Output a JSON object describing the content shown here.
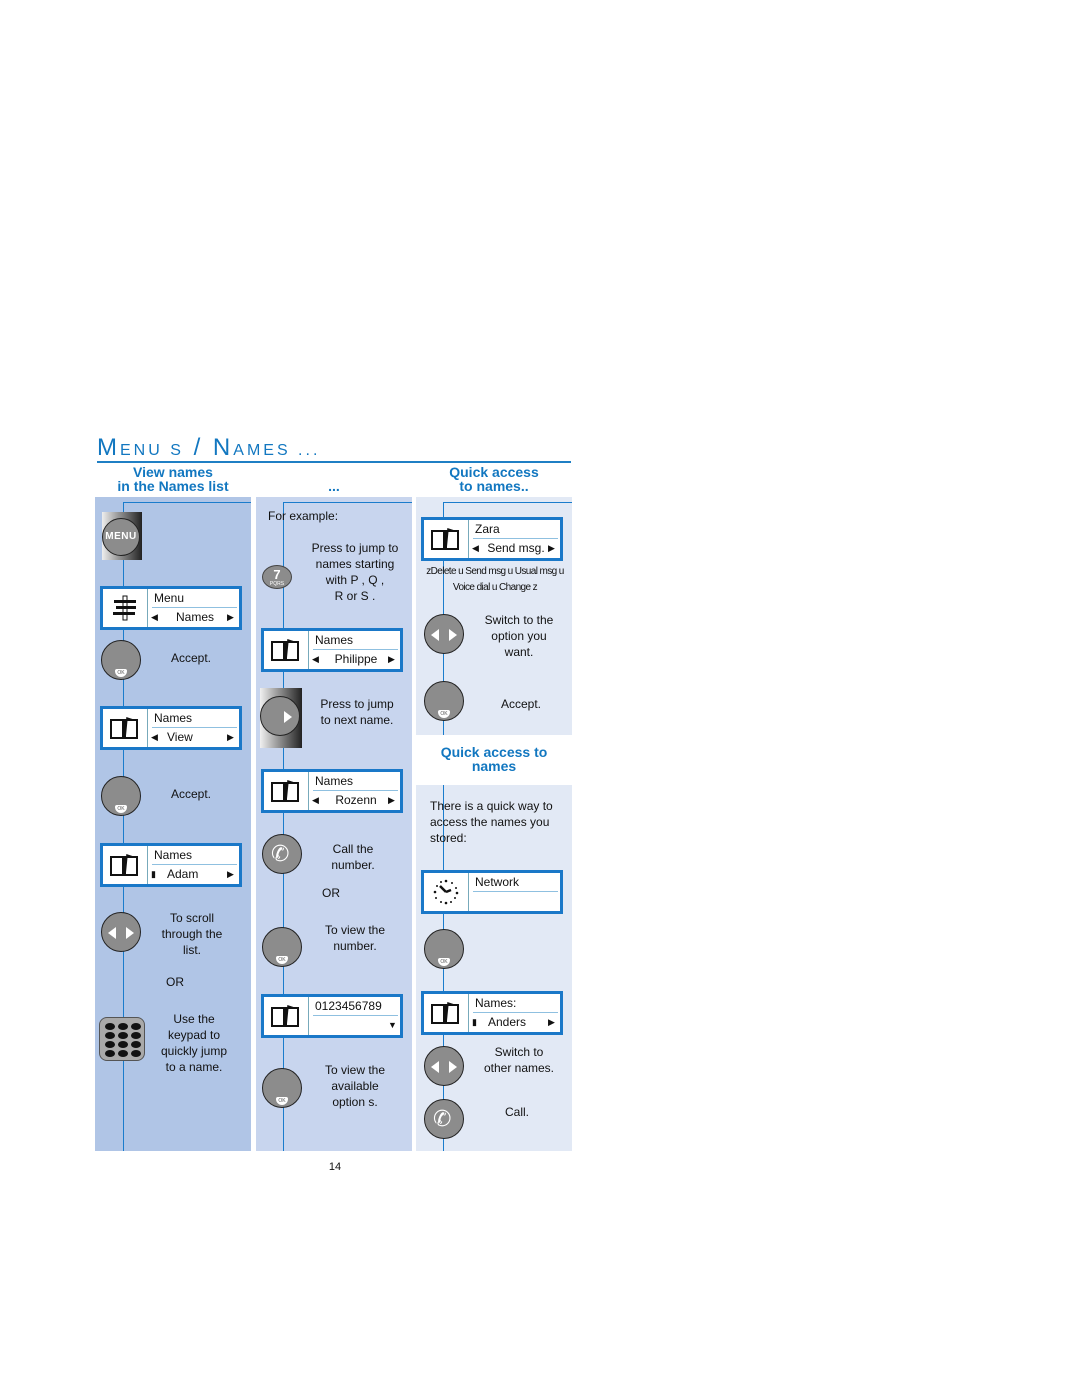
{
  "page": {
    "title_parts": [
      {
        "text": "M",
        "size": "big"
      },
      {
        "text": "ENU S",
        "size": "sm"
      },
      {
        "text": " / ",
        "size": "big"
      },
      {
        "text": "N",
        "size": "big"
      },
      {
        "text": "AMES ...",
        "size": "sm"
      }
    ],
    "page_number": "14",
    "accent_color": "#1277c0"
  },
  "columns": {
    "col1_head": [
      "View names",
      "in the Names list"
    ],
    "col2_head": "...",
    "col3_head": [
      "Quick access",
      "to names.."
    ],
    "col3_subhead": [
      "Quick access to",
      "names"
    ]
  },
  "col1": {
    "menu_key_label": "MENU",
    "screen_menu": {
      "line1": "Menu",
      "line2": "Names",
      "icon": "menu-tools-icon"
    },
    "accept1": "Accept.",
    "screen_view": {
      "line1": "Names",
      "line2": "View",
      "icon": "book-icon"
    },
    "accept2": "Accept.",
    "screen_adam": {
      "line1": "Names",
      "line2": "Adam",
      "icon": "book-icon"
    },
    "scroll_text": [
      "To scroll",
      "through the",
      "list."
    ],
    "or": "OR",
    "keypad_text": [
      "Use the",
      "keypad to",
      "quickly jump",
      "to a name."
    ],
    "ok_label": "OK"
  },
  "col2": {
    "for_example": "For example:",
    "key7": {
      "digit": "7",
      "letters": "PQRS"
    },
    "jump_text": [
      "Press to jump to",
      "names starting",
      "with  P , Q ,",
      "R  or  S ."
    ],
    "screen_philippe": {
      "line1": "Names",
      "line2": "Philippe"
    },
    "next_text": [
      "Press to jump",
      "to next name."
    ],
    "screen_rozenn": {
      "line1": "Names",
      "line2": "Rozenn"
    },
    "call_text": [
      "Call the",
      "number."
    ],
    "or": "OR",
    "view_number_text": [
      "To view the",
      "number."
    ],
    "screen_number": {
      "line1": "0123456789"
    },
    "options_text": [
      "To view the",
      "available",
      "option s."
    ]
  },
  "col3": {
    "screen_zara": {
      "line1": "Zara",
      "line2": "Send msg."
    },
    "options_line1": "zDelete  u Send msg u Usual msg  u",
    "options_line2": "Voice dial     u Change z",
    "switch_text": [
      "Switch to the",
      "option you",
      "want."
    ],
    "accept": "Accept.",
    "intro_text": [
      "There is a quick way to",
      "access the names you",
      "stored:"
    ],
    "screen_network": {
      "line1": "Network",
      "icon": "clock-icon"
    },
    "screen_anders": {
      "line1": "Names:",
      "line2": "Anders"
    },
    "switch_names_text": [
      "Switch to",
      "other names."
    ],
    "call": "Call."
  }
}
